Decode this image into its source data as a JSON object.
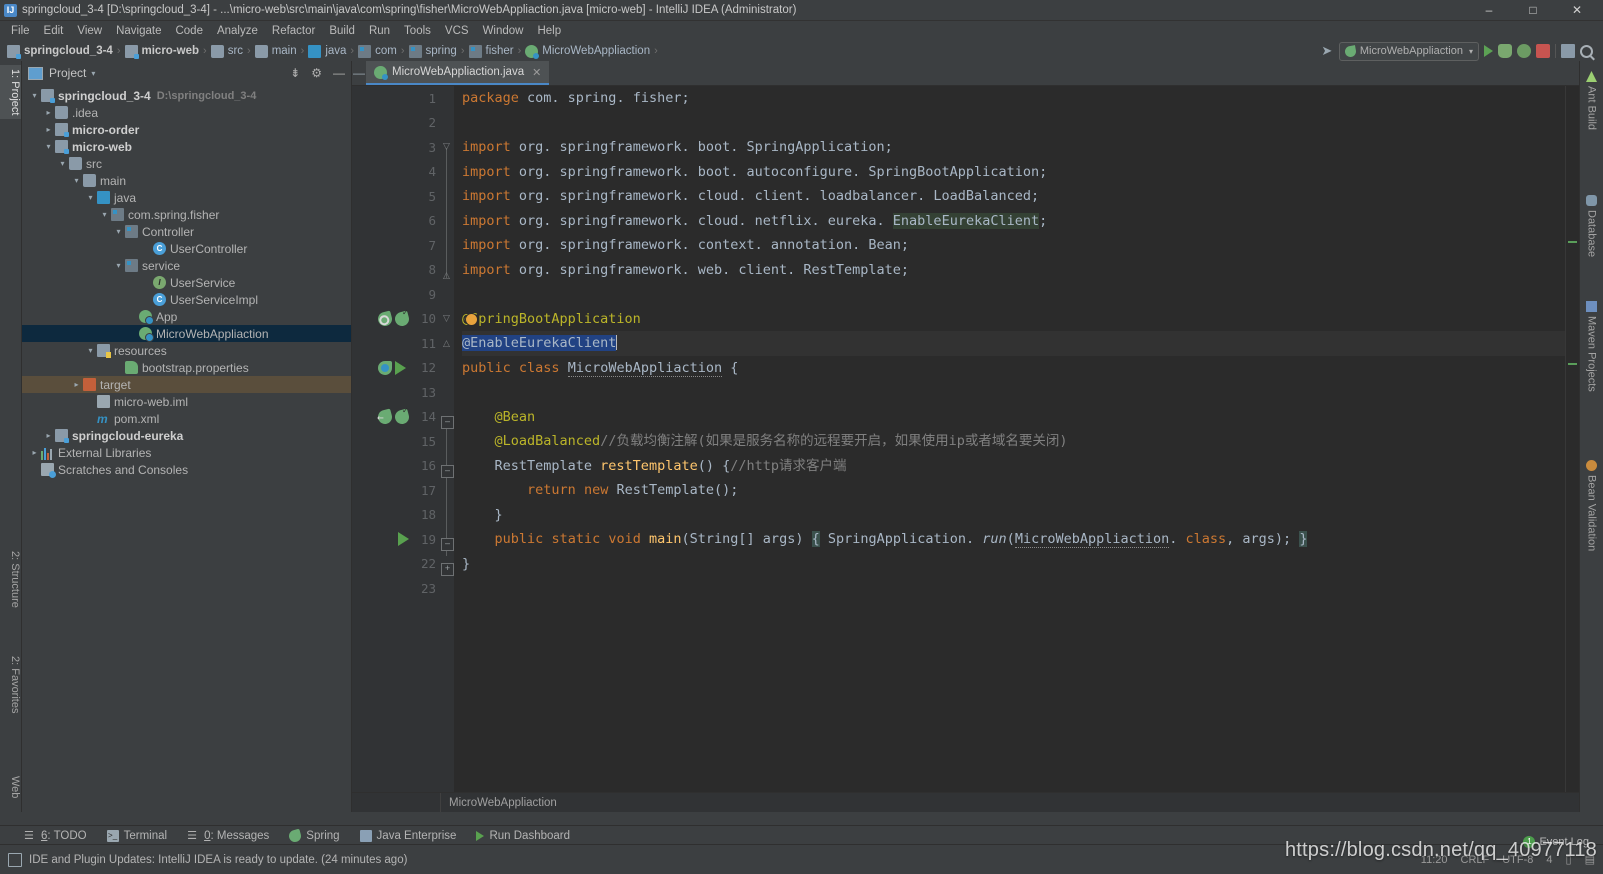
{
  "window": {
    "title": "springcloud_3-4 [D:\\springcloud_3-4] - ...\\micro-web\\src\\main\\java\\com\\spring\\fisher\\MicroWebAppliaction.java [micro-web] - IntelliJ IDEA (Administrator)",
    "app_badge": "IJ",
    "minimize": "–",
    "maximize": "□",
    "close": "✕"
  },
  "menu": {
    "items": [
      "File",
      "Edit",
      "View",
      "Navigate",
      "Code",
      "Analyze",
      "Refactor",
      "Build",
      "Run",
      "Tools",
      "VCS",
      "Window",
      "Help"
    ]
  },
  "navbar": {
    "crumbs": [
      {
        "label": "springcloud_3-4",
        "icon": "module-icon",
        "bold": true
      },
      {
        "label": "micro-web",
        "icon": "module-icon",
        "bold": true
      },
      {
        "label": "src",
        "icon": "folder-source-icon",
        "bold": false
      },
      {
        "label": "main",
        "icon": "folder-icon",
        "bold": false
      },
      {
        "label": "java",
        "icon": "folder-source-icon",
        "bold": false
      },
      {
        "label": "com",
        "icon": "package-icon",
        "bold": false
      },
      {
        "label": "spring",
        "icon": "package-icon",
        "bold": false
      },
      {
        "label": "fisher",
        "icon": "package-icon",
        "bold": false
      },
      {
        "label": "MicroWebAppliaction",
        "icon": "spring-class-icon",
        "bold": false
      }
    ],
    "separator": "›",
    "run_config": "MicroWebAppliaction",
    "run_config_caret": "▾",
    "buttons": [
      "build-icon",
      "run-button",
      "debug-button",
      "coverage-button",
      "stop-button",
      "project-structure-button",
      "search-everywhere-button"
    ]
  },
  "left_stripe": {
    "project_label": "1: Project",
    "structure_label": "2: Structure",
    "favorites_label": "2: Favorites",
    "web_label": "Web"
  },
  "project_panel": {
    "title": "Project",
    "caret": "▾",
    "tools": [
      "collapse-all-icon",
      "settings-gear-icon",
      "hide-icon"
    ],
    "tree": [
      {
        "label": "springcloud_3-4",
        "path": "D:\\springcloud_3-4",
        "indent": 0,
        "arrow": "▾",
        "icon": "module-icon",
        "bold": true,
        "state": ""
      },
      {
        "label": ".idea",
        "path": "",
        "indent": 1,
        "arrow": "▸",
        "icon": "folder-icon",
        "bold": false,
        "state": ""
      },
      {
        "label": "micro-order",
        "path": "",
        "indent": 1,
        "arrow": "▸",
        "icon": "module-icon",
        "bold": true,
        "state": ""
      },
      {
        "label": "micro-web",
        "path": "",
        "indent": 1,
        "arrow": "▾",
        "icon": "module-icon",
        "bold": true,
        "state": ""
      },
      {
        "label": "src",
        "path": "",
        "indent": 2,
        "arrow": "▾",
        "icon": "folder-icon",
        "bold": false,
        "state": ""
      },
      {
        "label": "main",
        "path": "",
        "indent": 3,
        "arrow": "▾",
        "icon": "folder-icon",
        "bold": false,
        "state": ""
      },
      {
        "label": "java",
        "path": "",
        "indent": 4,
        "arrow": "▾",
        "icon": "folder-source-icon",
        "bold": false,
        "state": ""
      },
      {
        "label": "com.spring.fisher",
        "path": "",
        "indent": 5,
        "arrow": "▾",
        "icon": "package-icon",
        "bold": false,
        "state": ""
      },
      {
        "label": "Controller",
        "path": "",
        "indent": 6,
        "arrow": "▾",
        "icon": "package-icon",
        "bold": false,
        "state": ""
      },
      {
        "label": "UserController",
        "path": "",
        "indent": 8,
        "arrow": "",
        "icon": "class-icon",
        "bold": false,
        "state": ""
      },
      {
        "label": "service",
        "path": "",
        "indent": 6,
        "arrow": "▾",
        "icon": "package-icon",
        "bold": false,
        "state": ""
      },
      {
        "label": "UserService",
        "path": "",
        "indent": 8,
        "arrow": "",
        "icon": "interface-icon",
        "bold": false,
        "state": ""
      },
      {
        "label": "UserServiceImpl",
        "path": "",
        "indent": 8,
        "arrow": "",
        "icon": "class-icon",
        "bold": false,
        "state": ""
      },
      {
        "label": "App",
        "path": "",
        "indent": 7,
        "arrow": "",
        "icon": "spring-app-icon",
        "bold": false,
        "state": ""
      },
      {
        "label": "MicroWebAppliaction",
        "path": "",
        "indent": 7,
        "arrow": "",
        "icon": "spring-app-icon",
        "bold": false,
        "state": "selected"
      },
      {
        "label": "resources",
        "path": "",
        "indent": 4,
        "arrow": "▾",
        "icon": "resources-folder-icon",
        "bold": false,
        "state": ""
      },
      {
        "label": "bootstrap.properties",
        "path": "",
        "indent": 6,
        "arrow": "",
        "icon": "properties-icon",
        "bold": false,
        "state": ""
      },
      {
        "label": "target",
        "path": "",
        "indent": 3,
        "arrow": "▸",
        "icon": "target-folder-icon",
        "bold": false,
        "state": "highlight"
      },
      {
        "label": "micro-web.iml",
        "path": "",
        "indent": 4,
        "arrow": "",
        "icon": "iml-icon",
        "bold": false,
        "state": ""
      },
      {
        "label": "pom.xml",
        "path": "",
        "indent": 4,
        "arrow": "",
        "icon": "maven-icon",
        "bold": false,
        "state": ""
      },
      {
        "label": "springcloud-eureka",
        "path": "",
        "indent": 1,
        "arrow": "▸",
        "icon": "module-icon",
        "bold": true,
        "state": ""
      },
      {
        "label": "External Libraries",
        "path": "",
        "indent": 0,
        "arrow": "▸",
        "icon": "libraries-icon",
        "bold": false,
        "state": ""
      },
      {
        "label": "Scratches and Consoles",
        "path": "",
        "indent": 0,
        "arrow": "",
        "icon": "scratches-icon",
        "bold": false,
        "state": ""
      }
    ]
  },
  "editor": {
    "tab": {
      "label": "MicroWebAppliaction.java",
      "icon": "spring-class-icon",
      "close": "✕"
    },
    "collapse_icon": "—",
    "footer_crumb": "MicroWebAppliaction",
    "line_numbers": [
      "1",
      "2",
      "3",
      "4",
      "5",
      "6",
      "7",
      "8",
      "9",
      "10",
      "11",
      "12",
      "13",
      "14",
      "15",
      "16",
      "17",
      "18",
      "19",
      "22",
      "23"
    ],
    "code_lines": [
      "package com. spring. fisher;",
      "",
      "import org. springframework. boot. SpringApplication;",
      "import org. springframework. boot. autoconfigure. SpringBootApplication;",
      "import org. springframework. cloud. client. loadbalancer. LoadBalanced;",
      "import org. springframework. cloud. netflix. eureka. EnableEurekaClient;",
      "import org. springframework. context. annotation. Bean;",
      "import org. springframework. web. client. RestTemplate;",
      "",
      "@SpringBootApplication",
      "@EnableEurekaClient",
      "public class MicroWebAppliaction {",
      "",
      "    @Bean",
      "    @LoadBalanced//负载均衡注解(如果是服务名称的远程要开启，如果使用ip或者域名要关闭)",
      "    RestTemplate restTemplate() {//http请求客户端",
      "        return new RestTemplate();",
      "    }",
      "    public static void main(String[] args) { SpringApplication. run(MicroWebAppliaction. class, args); }",
      "}",
      ""
    ]
  },
  "right_stripe": {
    "items": [
      {
        "label": "Ant Build",
        "icon": "ant-build-icon"
      },
      {
        "label": "Database",
        "icon": "database-icon"
      },
      {
        "label": "Maven Projects",
        "icon": "maven-projects-icon"
      },
      {
        "label": "Bean Validation",
        "icon": "bean-validation-icon"
      }
    ]
  },
  "bottom_toolwindows": {
    "items": [
      {
        "label": "6: TODO",
        "icon": "todo-icon",
        "mnemonic": "6"
      },
      {
        "label": "Terminal",
        "icon": "terminal-icon",
        "mnemonic": ""
      },
      {
        "label": "0: Messages",
        "icon": "messages-icon",
        "mnemonic": "0"
      },
      {
        "label": "Spring",
        "icon": "spring-icon",
        "mnemonic": ""
      },
      {
        "label": "Java Enterprise",
        "icon": "java-enterprise-icon",
        "mnemonic": ""
      },
      {
        "label": "Run Dashboard",
        "icon": "run-dashboard-icon",
        "mnemonic": ""
      }
    ]
  },
  "statusbar": {
    "message": "IDE and Plugin Updates: IntelliJ IDEA is ready to update. (24 minutes ago)",
    "icon": "notification-icon",
    "caret_position": "11:20",
    "line_separator": "CRLF",
    "encoding": "UTF-8",
    "indent": "4",
    "event_log_label": "Event Log",
    "event_log_count": "1"
  },
  "watermark": "https://blog.csdn.net/qq_40977118",
  "colors": {
    "bg": "#3c3f41",
    "editor_bg": "#2b2b2b",
    "gutter_bg": "#313335",
    "accent": "#4a88c7",
    "selection": "#0d293e",
    "keyword": "#cc7832",
    "annotation": "#bbb529",
    "comment": "#808080",
    "plain": "#a9b7c6",
    "spring_green": "#6aab73"
  }
}
